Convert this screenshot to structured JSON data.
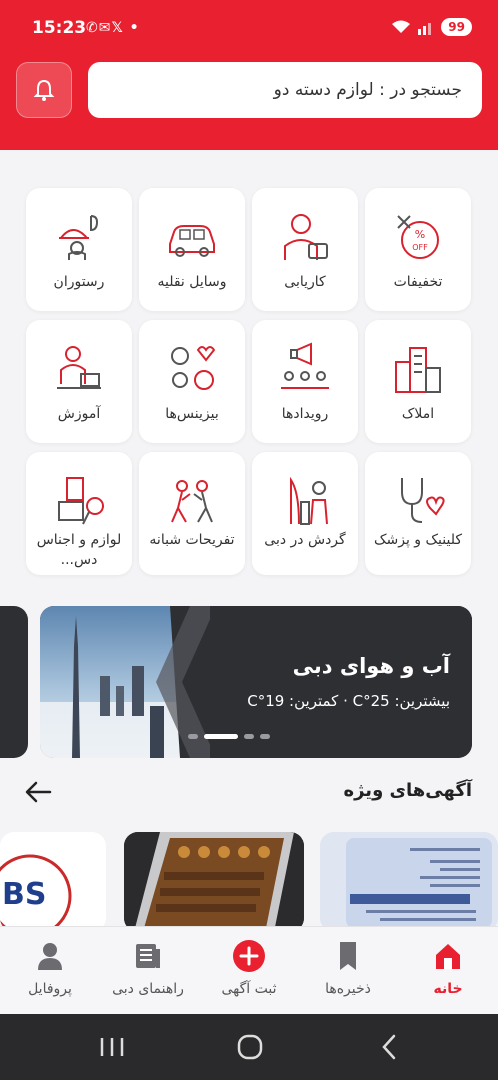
{
  "status_bar": {
    "time": "15:23",
    "notif_icons": "✆✉𝕏 •",
    "signal_icons": "wifi signal",
    "battery": "99"
  },
  "header": {
    "search_placeholder": "جستجو در : لوازم دسته دو",
    "bell_icon": "bell-icon",
    "accent_color": "#e8202f"
  },
  "categories": [
    {
      "label": "تخفیفات",
      "icon": "discount-icon"
    },
    {
      "label": "کاریابی",
      "icon": "job-icon"
    },
    {
      "label": "وسایل نقلیه",
      "icon": "car-icon"
    },
    {
      "label": "رستوران",
      "icon": "restaurant-icon"
    },
    {
      "label": "املاک",
      "icon": "buildings-icon"
    },
    {
      "label": "رویدادها",
      "icon": "events-icon"
    },
    {
      "label": "بیزینس‌ها",
      "icon": "business-icon"
    },
    {
      "label": "آموزش",
      "icon": "education-icon"
    },
    {
      "label": "کلینیک و پزشک",
      "icon": "clinic-icon"
    },
    {
      "label": "گردش در دبی",
      "icon": "tourism-icon"
    },
    {
      "label": "تفریحات شبانه",
      "icon": "nightlife-icon"
    },
    {
      "label": "لوازم و اجناس دس...",
      "icon": "goods-icon"
    }
  ],
  "weather_banner": {
    "title": "آب و هوای دبی",
    "subtitle": "بیشترین: C°25 · کمترین: C°19",
    "slide_count": 4,
    "active_slide": 2
  },
  "featured": {
    "title": "آگهی‌های ویژه",
    "arrow_icon": "arrow-left-icon"
  },
  "bottom_nav": [
    {
      "label": "خانه",
      "icon": "home-icon",
      "active": true
    },
    {
      "label": "ذخیره‌ها",
      "icon": "bookmark-icon",
      "active": false
    },
    {
      "label": "ثبت آگهی",
      "icon": "add-icon",
      "active": false
    },
    {
      "label": "راهنمای دبی",
      "icon": "guide-icon",
      "active": false
    },
    {
      "label": "پروفایل",
      "icon": "profile-icon",
      "active": false
    }
  ]
}
